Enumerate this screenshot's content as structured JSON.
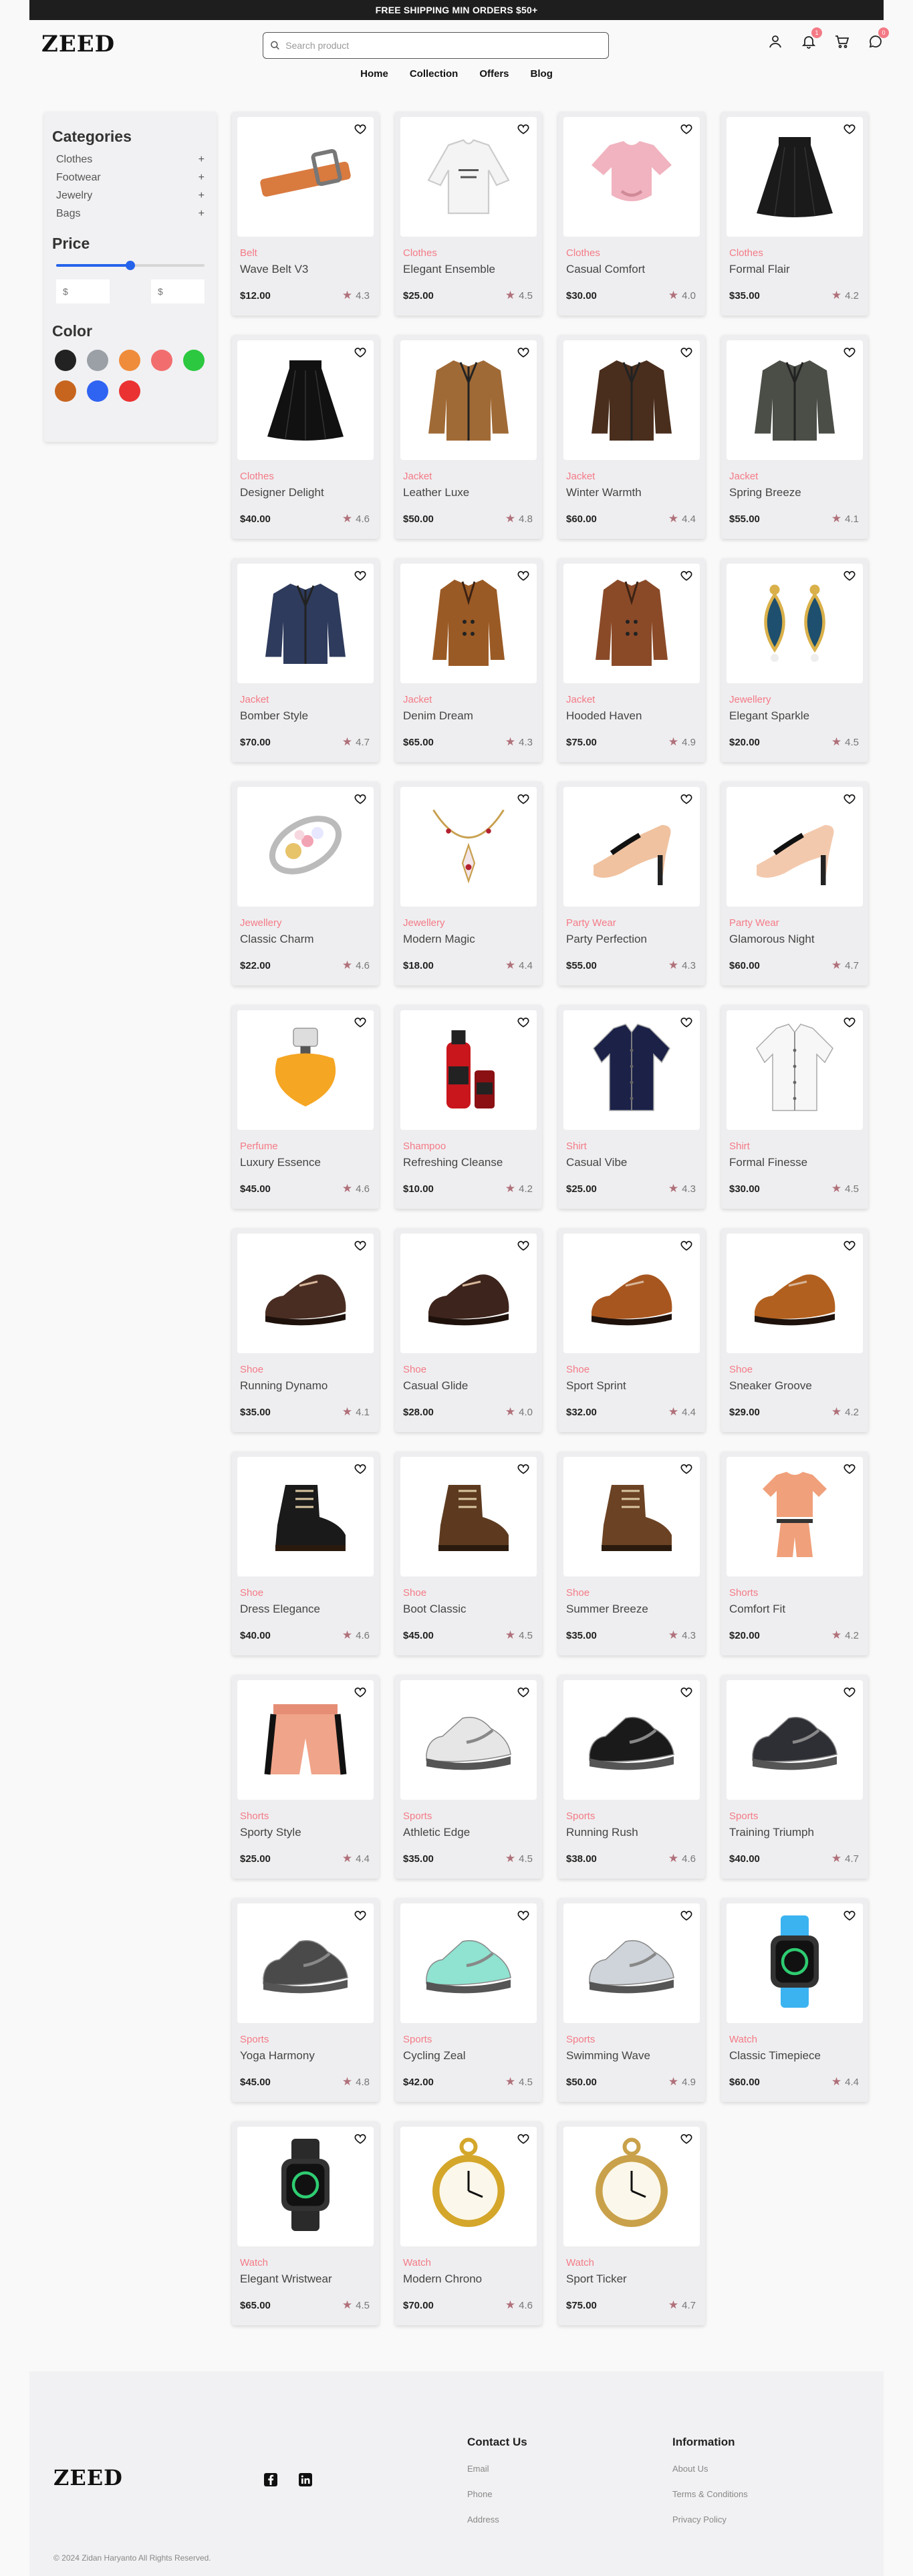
{
  "banner": {
    "text": "FREE SHIPPING MIN ORDERS $50+"
  },
  "header": {
    "logo": "ZEED",
    "search_placeholder": "Search product",
    "wishlist_count": "1",
    "chat_count": "0"
  },
  "nav": {
    "items": [
      "Home",
      "Collection",
      "Offers",
      "Blog"
    ]
  },
  "sidebar": {
    "categories_title": "Categories",
    "categories": [
      "Clothes",
      "Footwear",
      "Jewelry",
      "Bags"
    ],
    "plus": "+",
    "price_title": "Price",
    "price_slider_value": 0.5,
    "min_placeholder": "$",
    "max_placeholder": "$",
    "color_title": "Color",
    "colors": [
      "#222222",
      "#9aa0a6",
      "#ef8c3b",
      "#f26e6e",
      "#2cc840",
      "#c7651f",
      "#2f63f2",
      "#ea3232"
    ]
  },
  "products": [
    {
      "category": "Belt",
      "name": "Wave Belt V3",
      "price": "$12.00",
      "rating": "4.3",
      "icon": "belt-icon",
      "color": "#d97a3f"
    },
    {
      "category": "Clothes",
      "name": "Elegant Ensemble",
      "price": "$25.00",
      "rating": "4.5",
      "icon": "sweater-icon",
      "color": "#f4f4f4"
    },
    {
      "category": "Clothes",
      "name": "Casual Comfort",
      "price": "$30.00",
      "rating": "4.0",
      "icon": "tshirt-icon",
      "color": "#f0b3bf"
    },
    {
      "category": "Clothes",
      "name": "Formal Flair",
      "price": "$35.00",
      "rating": "4.2",
      "icon": "skirt-icon",
      "color": "#1a1a1a"
    },
    {
      "category": "Clothes",
      "name": "Designer Delight",
      "price": "$40.00",
      "rating": "4.6",
      "icon": "skirt-icon",
      "color": "#111111"
    },
    {
      "category": "Jacket",
      "name": "Leather Luxe",
      "price": "$50.00",
      "rating": "4.8",
      "icon": "jacket-icon",
      "color": "#a06a36"
    },
    {
      "category": "Jacket",
      "name": "Winter Warmth",
      "price": "$60.00",
      "rating": "4.4",
      "icon": "jacket-icon",
      "color": "#4a2e1d"
    },
    {
      "category": "Jacket",
      "name": "Spring Breeze",
      "price": "$55.00",
      "rating": "4.1",
      "icon": "jacket-icon",
      "color": "#4a4e47"
    },
    {
      "category": "Jacket",
      "name": "Bomber Style",
      "price": "$70.00",
      "rating": "4.7",
      "icon": "jacket-icon",
      "color": "#2e3b5c"
    },
    {
      "category": "Jacket",
      "name": "Denim Dream",
      "price": "$65.00",
      "rating": "4.3",
      "icon": "coat-icon",
      "color": "#9a5a25"
    },
    {
      "category": "Jacket",
      "name": "Hooded Haven",
      "price": "$75.00",
      "rating": "4.9",
      "icon": "coat-icon",
      "color": "#8a4a28"
    },
    {
      "category": "Jewellery",
      "name": "Elegant Sparkle",
      "price": "$20.00",
      "rating": "4.5",
      "icon": "earrings-icon",
      "color": "#1e4f6e"
    },
    {
      "category": "Jewellery",
      "name": "Classic Charm",
      "price": "$22.00",
      "rating": "4.6",
      "icon": "ring-icon",
      "color": "#e7c36a"
    },
    {
      "category": "Jewellery",
      "name": "Modern Magic",
      "price": "$18.00",
      "rating": "4.4",
      "icon": "necklace-icon",
      "color": "#c8a050"
    },
    {
      "category": "Party Wear",
      "name": "Party Perfection",
      "price": "$55.00",
      "rating": "4.3",
      "icon": "heel-icon",
      "color": "#f0c2a0"
    },
    {
      "category": "Party Wear",
      "name": "Glamorous Night",
      "price": "$60.00",
      "rating": "4.7",
      "icon": "heel-icon",
      "color": "#f3c9ad"
    },
    {
      "category": "Perfume",
      "name": "Luxury Essence",
      "price": "$45.00",
      "rating": "4.6",
      "icon": "perfume-icon",
      "color": "#f5a623"
    },
    {
      "category": "Shampoo",
      "name": "Refreshing Cleanse",
      "price": "$10.00",
      "rating": "4.2",
      "icon": "bottle-icon",
      "color": "#c8161c"
    },
    {
      "category": "Shirt",
      "name": "Casual Vibe",
      "price": "$25.00",
      "rating": "4.3",
      "icon": "shirt-icon",
      "color": "#1b2147"
    },
    {
      "category": "Shirt",
      "name": "Formal Finesse",
      "price": "$30.00",
      "rating": "4.5",
      "icon": "shirt-icon",
      "color": "#f7f7f7"
    },
    {
      "category": "Shoe",
      "name": "Running Dynamo",
      "price": "$35.00",
      "rating": "4.1",
      "icon": "shoe-icon",
      "color": "#4a2d22"
    },
    {
      "category": "Shoe",
      "name": "Casual Glide",
      "price": "$28.00",
      "rating": "4.0",
      "icon": "shoe-icon",
      "color": "#3d241c"
    },
    {
      "category": "Shoe",
      "name": "Sport Sprint",
      "price": "$32.00",
      "rating": "4.4",
      "icon": "shoe-icon",
      "color": "#a8561f"
    },
    {
      "category": "Shoe",
      "name": "Sneaker Groove",
      "price": "$29.00",
      "rating": "4.2",
      "icon": "shoe-icon",
      "color": "#b2601f"
    },
    {
      "category": "Shoe",
      "name": "Dress Elegance",
      "price": "$40.00",
      "rating": "4.6",
      "icon": "boot-icon",
      "color": "#1a1a1a"
    },
    {
      "category": "Shoe",
      "name": "Boot Classic",
      "price": "$45.00",
      "rating": "4.5",
      "icon": "boot-icon",
      "color": "#5d3a1f"
    },
    {
      "category": "Shoe",
      "name": "Summer Breeze",
      "price": "$35.00",
      "rating": "4.3",
      "icon": "boot-icon",
      "color": "#6b4223"
    },
    {
      "category": "Shorts",
      "name": "Comfort Fit",
      "price": "$20.00",
      "rating": "4.2",
      "icon": "outfit-icon",
      "color": "#f0a07a"
    },
    {
      "category": "Shorts",
      "name": "Sporty Style",
      "price": "$25.00",
      "rating": "4.4",
      "icon": "shorts-icon",
      "color": "#f0a48a"
    },
    {
      "category": "Sports",
      "name": "Athletic Edge",
      "price": "$35.00",
      "rating": "4.5",
      "icon": "sneaker-icon",
      "color": "#e6e6e6"
    },
    {
      "category": "Sports",
      "name": "Running Rush",
      "price": "$38.00",
      "rating": "4.6",
      "icon": "sneaker-icon",
      "color": "#1a1a1a"
    },
    {
      "category": "Sports",
      "name": "Training Triumph",
      "price": "$40.00",
      "rating": "4.7",
      "icon": "sneaker-icon",
      "color": "#2e2e35"
    },
    {
      "category": "Sports",
      "name": "Yoga Harmony",
      "price": "$45.00",
      "rating": "4.8",
      "icon": "sneaker-icon",
      "color": "#4a4a4a"
    },
    {
      "category": "Sports",
      "name": "Cycling Zeal",
      "price": "$42.00",
      "rating": "4.5",
      "icon": "sneaker-icon",
      "color": "#8fe3d0"
    },
    {
      "category": "Sports",
      "name": "Swimming Wave",
      "price": "$50.00",
      "rating": "4.9",
      "icon": "sneaker-icon",
      "color": "#cfd4da"
    },
    {
      "category": "Watch",
      "name": "Classic Timepiece",
      "price": "$60.00",
      "rating": "4.4",
      "icon": "smartwatch-icon",
      "color": "#3bb3f0"
    },
    {
      "category": "Watch",
      "name": "Elegant Wristwear",
      "price": "$65.00",
      "rating": "4.5",
      "icon": "smartwatch-icon",
      "color": "#2a2a2a"
    },
    {
      "category": "Watch",
      "name": "Modern Chrono",
      "price": "$70.00",
      "rating": "4.6",
      "icon": "pocketwatch-icon",
      "color": "#d4a62a"
    },
    {
      "category": "Watch",
      "name": "Sport Ticker",
      "price": "$75.00",
      "rating": "4.7",
      "icon": "pocketwatch-icon",
      "color": "#c9a14a"
    }
  ],
  "footer": {
    "logo": "ZEED",
    "contact_title": "Contact Us",
    "contact_links": [
      "Email",
      "Phone",
      "Address"
    ],
    "info_title": "Information",
    "info_links": [
      "About Us",
      "Terms & Conditions",
      "Privacy Policy"
    ],
    "copyright": "© 2024 Zidan Haryanto All Rights Reserved."
  },
  "colors": {
    "accent": "#f47a86",
    "slider": "#2563eb",
    "star": "#b0707a"
  }
}
